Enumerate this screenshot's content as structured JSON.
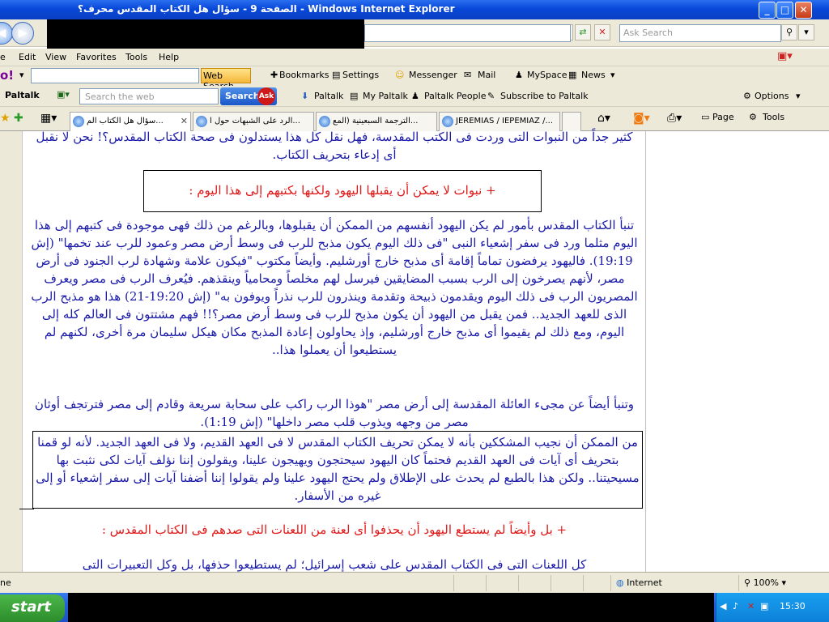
{
  "window": {
    "title": "الصفحة 9 - سؤال هل الكتاب المقدس محرف؟ - Windows Internet Explorer",
    "minimize": "_",
    "maximize": "□",
    "close": "✕"
  },
  "address": {
    "search_placeholder": "Ask Search"
  },
  "menu": {
    "items": [
      "e",
      "Edit",
      "View",
      "Favorites",
      "Tools",
      "Help"
    ]
  },
  "yahoo_toolbar": {
    "logo": "o!",
    "web_search": "Web Search",
    "bookmarks": "Bookmarks",
    "settings": "Settings",
    "messenger": "Messenger",
    "mail": "Mail",
    "myspace": "MySpace",
    "news": "News"
  },
  "paltalk_toolbar": {
    "label": "Paltalk",
    "search_placeholder": "Search the web",
    "search_button": "Search",
    "ask": "Ask",
    "items": [
      "Paltalk",
      "My Paltalk",
      "Paltalk People",
      "Subscribe to Paltalk"
    ],
    "options": "Options"
  },
  "tabs": [
    {
      "label": "سؤال هل الكتاب الم...",
      "active": true
    },
    {
      "label": "الرد على الشبهات حول ا...",
      "active": false
    },
    {
      "label": "الترجمة السبعينية (المع...",
      "active": false
    },
    {
      "label": "JEREMIAS / IEPEMIAZ /...",
      "active": false
    }
  ],
  "tab_tools": {
    "page": "Page",
    "tools": "Tools"
  },
  "content": {
    "top_partial": "كثير جداً من النبوات التى وردت فى الكتب المقدسة، فهل نقل كل هذا يستدلون فى صحة الكتاب المقدس؟! نحن لا نقبل أى إدعاء بتحريف الكتاب.",
    "heading1": "+ نبوات لا يمكن أن يقبلها اليهود ولكنها بكتبهم إلى هذا اليوم :",
    "para1": "تنبأ الكتاب المقدس بأمور لم يكن اليهود أنفسهم من الممكن أن يقبلوها، وبالرغم من ذلك فهى موجودة فى كتبهم إلى هذا اليوم مثلما ورد فى سفر إشعياء النبى \"فى ذلك اليوم يكون مذبح للرب فى وسط أرض مصر وعمود للرب عند تخمها\" (إش 19:19). فاليهود يرفضون تماماً إقامة أى مذبح خارج أورشليم. وأيضاً مكتوب \"فيكون علامة وشهادة لرب الجنود فى أرض مصر، لأنهم يصرخون إلى الرب بسبب المضايقين فيرسل لهم مخلصاً ومحامياً وينقذهم. فيُعرف الرب فى مصر ويعرف المصريون الرب فى ذلك اليوم ويقدمون ذبيحة وتقدمة وينذرون للرب نذراً ويوفون به\" (إش 19:20-21) هذا هو مذبح الرب الذى للعهد الجديد.. فمن يقبل من اليهود أن يكون مذبح للرب فى وسط أرض مصر؟!! فهم مشتتون فى العالم كله إلى اليوم، ومع ذلك لم يقيموا أى مذبح خارج أورشليم، وإذ يحاولون إعادة المذبح مكان هيكل سليمان مرة أخرى، لكنهم لم يستطيعوا أن يعملوا هذا..",
    "para2": "وتنبأ أيضاً عن مجىء العائلة المقدسة إلى أرض مصر \"هوذا الرب راكب على سحابة سريعة وقادم إلى مصر فترتجف أوثان مصر من وجهه ويذوب قلب مصر داخلها\" (إش 1:19).",
    "boxed": "من الممكن أن نجيب المشككين بأنه لا يمكن تحريف الكتاب المقدس لا فى العهد القديم، ولا فى العهد الجديد. لأنه لو قمنا بتحريف أى آيات فى العهد القديم فحتماً كان اليهود سيحتجون ويهيجون علينا، ويقولون إننا نؤلف آيات لكى نثبت بها مسيحيتنا.. ولكن هذا بالطبع لم يحدث على الإطلاق ولم يحتج اليهود علينا ولم يقولوا إننا أضفنا آيات إلى سفر إشعياء أو إلى غيره من الأسفار.",
    "heading2": "+ بل وأيضاً لم يستطع اليهود أن يحذفوا أى لعنة من اللعنات التى صدهم فى الكتاب المقدس :",
    "para3": "كل اللعنات التى فى الكتاب المقدس على شعب إسرائيل؛ لم يستطيعوا حذفها، بل وكل التعبيرات التى"
  },
  "status": {
    "left": "ne",
    "zone": "Internet",
    "zoom": "100%"
  },
  "taskbar": {
    "start": "start",
    "clock": "15:30"
  }
}
